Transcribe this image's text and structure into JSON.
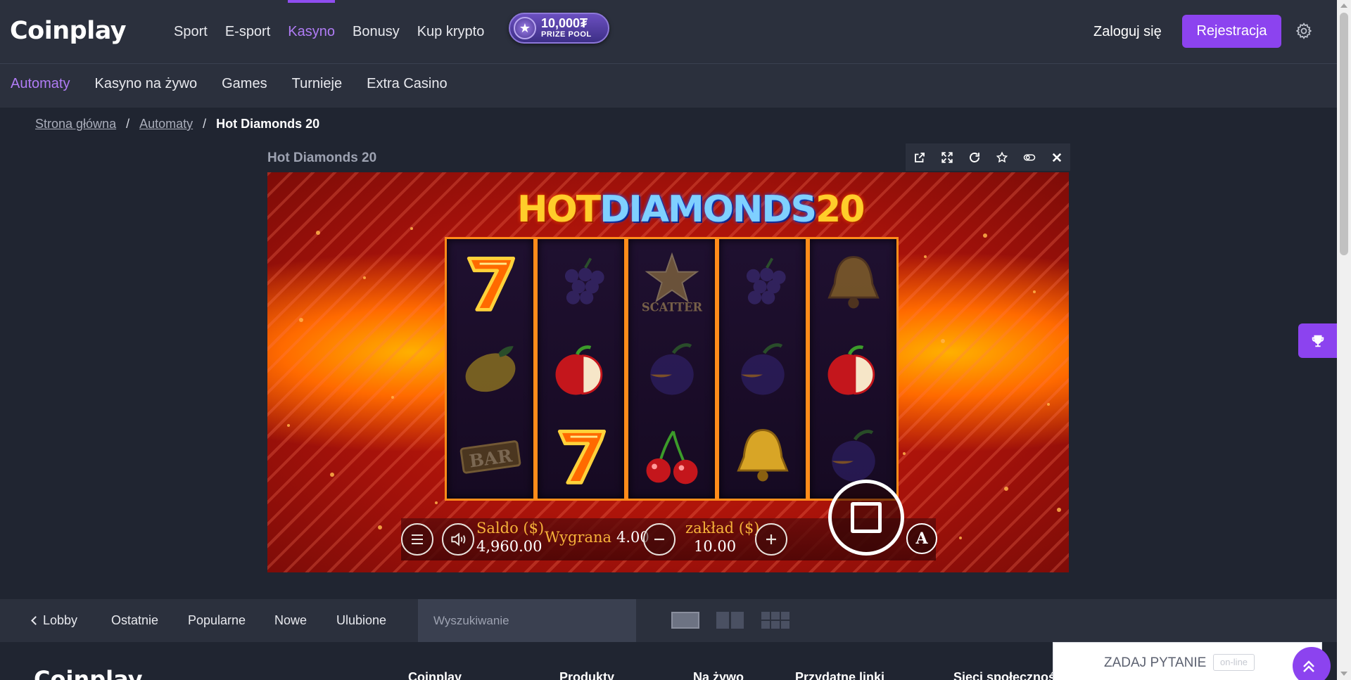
{
  "header": {
    "logo": "Coinplay",
    "nav": [
      {
        "label": "Sport"
      },
      {
        "label": "E-sport"
      },
      {
        "label": "Kasyno",
        "active": true
      },
      {
        "label": "Bonusy"
      },
      {
        "label": "Kup krypto"
      }
    ],
    "prize_pool": {
      "amount": "10,000₮",
      "label": "PRIZE POOL"
    },
    "login": "Zaloguj się",
    "register": "Rejestracja",
    "accent": "#8c43ef"
  },
  "subnav": [
    {
      "label": "Automaty",
      "active": true
    },
    {
      "label": "Kasyno na żywo"
    },
    {
      "label": "Games"
    },
    {
      "label": "Turnieje"
    },
    {
      "label": "Extra Casino"
    }
  ],
  "breadcrumb": {
    "items": [
      "Strona główna",
      "Automaty"
    ],
    "current": "Hot Diamonds 20",
    "separator": "/"
  },
  "game": {
    "title": "Hot Diamonds 20",
    "logo": {
      "hot": "HOT",
      "diamonds": "DIAMONDS",
      "num": "20"
    },
    "toolbar": [
      "external-link-icon",
      "fullscreen-icon",
      "reload-icon",
      "star-icon",
      "toggle-icon",
      "close-icon"
    ],
    "reels": [
      [
        "seven",
        "lemon",
        "bar"
      ],
      [
        "grapes",
        "apple",
        "seven"
      ],
      [
        "star-scatter",
        "plum",
        "cherries"
      ],
      [
        "grapes",
        "plum",
        "bell"
      ],
      [
        "bell",
        "apple",
        "plum"
      ]
    ],
    "scatter_text": "SCATTER",
    "bar_text": "BAR",
    "hud": {
      "balance_label": "Saldo ($)",
      "balance": "4,960.00",
      "win_label": "Wygrana",
      "win": "4.00",
      "bet_label": "zakład ($)",
      "bet": "10.00",
      "auto": "A"
    }
  },
  "gamebar": {
    "lobby": "Lobby",
    "tabs": [
      "Ostatnie",
      "Popularne",
      "Nowe",
      "Ulubione"
    ],
    "search_placeholder": "Wyszukiwanie"
  },
  "footer": {
    "logo": "Coinplay",
    "columns": [
      "Coinplay",
      "Produkty",
      "Na żywo",
      "Przydatne linki",
      "Sieci społecznoś"
    ]
  },
  "chat": {
    "ask": "ZADAJ PYTANIE",
    "status": "on-line"
  }
}
